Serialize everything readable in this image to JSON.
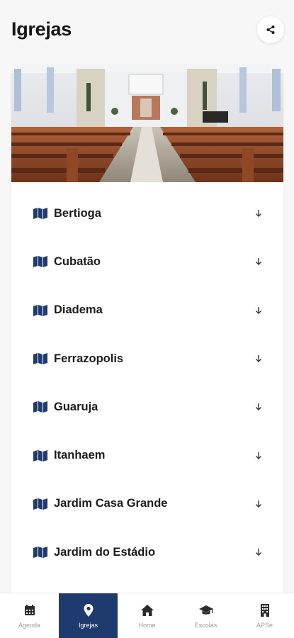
{
  "header": {
    "title": "Igrejas",
    "share_icon": "share-icon"
  },
  "hero": {
    "image": "church-interior-photo"
  },
  "churches": [
    {
      "label": "Bertioga",
      "icon": "map-icon"
    },
    {
      "label": "Cubatão",
      "icon": "map-icon"
    },
    {
      "label": "Diadema",
      "icon": "map-icon"
    },
    {
      "label": "Ferrazopolis",
      "icon": "map-icon"
    },
    {
      "label": "Guaruja",
      "icon": "map-icon"
    },
    {
      "label": "Itanhaem",
      "icon": "map-icon"
    },
    {
      "label": "Jardim Casa Grande",
      "icon": "map-icon"
    },
    {
      "label": "Jardim do Estádio",
      "icon": "map-icon"
    }
  ],
  "bottom_nav": [
    {
      "label": "Agenda",
      "icon": "calendar-icon",
      "active": false
    },
    {
      "label": "Igrejas",
      "icon": "location-pin-icon",
      "active": true
    },
    {
      "label": "Home",
      "icon": "home-icon",
      "active": false
    },
    {
      "label": "Escolas",
      "icon": "graduation-cap-icon",
      "active": false
    },
    {
      "label": "APSe",
      "icon": "building-icon",
      "active": false
    }
  ],
  "colors": {
    "accent": "#1e3a6e",
    "icon_blue": "#1e3a6e",
    "background": "#f7f7f8",
    "nav_inactive": "#9a9aa0"
  }
}
